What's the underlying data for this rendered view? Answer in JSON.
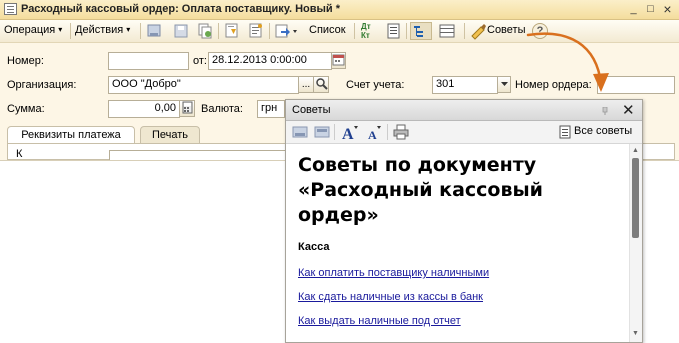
{
  "window": {
    "title": "Расходный кассовый ордер: Оплата поставщику. Новый *",
    "controls": {
      "minimize": "_",
      "maximize": "□",
      "close": "×"
    }
  },
  "toolbar": {
    "operation_label": "Операция",
    "actions_label": "Действия",
    "list_label": "Список",
    "dt_kt_label": "Дт Кт",
    "tips_label": "Советы",
    "caret": "▾"
  },
  "form": {
    "number_label": "Номер:",
    "number_value": "",
    "date_from_label": "от:",
    "date_value": "28.12.2013 0:00:00",
    "organization_label": "Организация:",
    "organization_value": "ООО \"Добро\"",
    "account_label": "Счет учета:",
    "account_value": "301",
    "order_number_label": "Номер ордера:",
    "order_number_value": "",
    "amount_label": "Сумма:",
    "amount_value": "0,00",
    "currency_label": "Валюта:",
    "currency_value": "грн",
    "ellipsis": "...",
    "partial_label": "К"
  },
  "tabs": [
    {
      "label": "Реквизиты платежа",
      "active": true
    },
    {
      "label": "Печать",
      "active": false
    }
  ],
  "tips_panel": {
    "title": "Советы",
    "all_tips_label": "Все советы",
    "close_label": "✕",
    "heading": "Советы по документу «Расходный кассовый ордер»",
    "section_title": "Касса",
    "links": [
      "Как оплатить поставщику наличными",
      "Как сдать наличные из кассы в банк",
      "Как выдать наличные под отчет"
    ]
  },
  "colors": {
    "window_bg": "#fdf6e6",
    "titlebar": "#f4dd9d",
    "arrow": "#d9701e",
    "link": "#1a1a9c"
  }
}
